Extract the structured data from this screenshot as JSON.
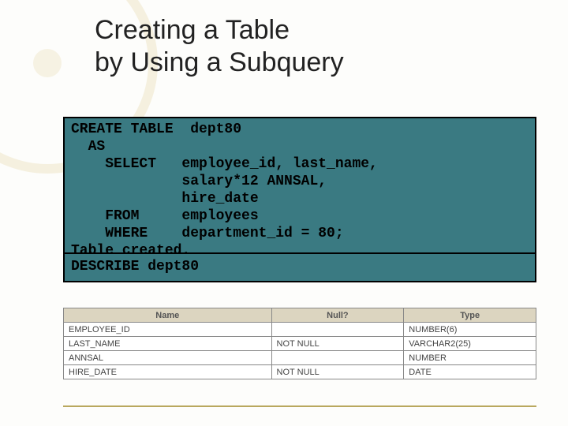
{
  "title_line1": "Creating a Table",
  "title_line2": "by Using a Subquery",
  "code1": {
    "l0": "CREATE TABLE  dept80",
    "l1": "  AS",
    "l2": "    SELECT   employee_id, last_name,",
    "l3": "             salary*12 ANNSAL,",
    "l4": "             hire_date",
    "l5": "    FROM     employees",
    "l6": "    WHERE    department_id = 80;",
    "l7": "Table created."
  },
  "code2": {
    "l0": "DESCRIBE dept80"
  },
  "table": {
    "headers": {
      "c1": "Name",
      "c2": "Null?",
      "c3": "Type"
    },
    "rows": [
      {
        "c1": "EMPLOYEE_ID",
        "c2": "",
        "c3": "NUMBER(6)"
      },
      {
        "c1": "LAST_NAME",
        "c2": "NOT NULL",
        "c3": "VARCHAR2(25)"
      },
      {
        "c1": "ANNSAL",
        "c2": "",
        "c3": "NUMBER"
      },
      {
        "c1": "HIRE_DATE",
        "c2": "NOT NULL",
        "c3": "DATE"
      }
    ]
  }
}
